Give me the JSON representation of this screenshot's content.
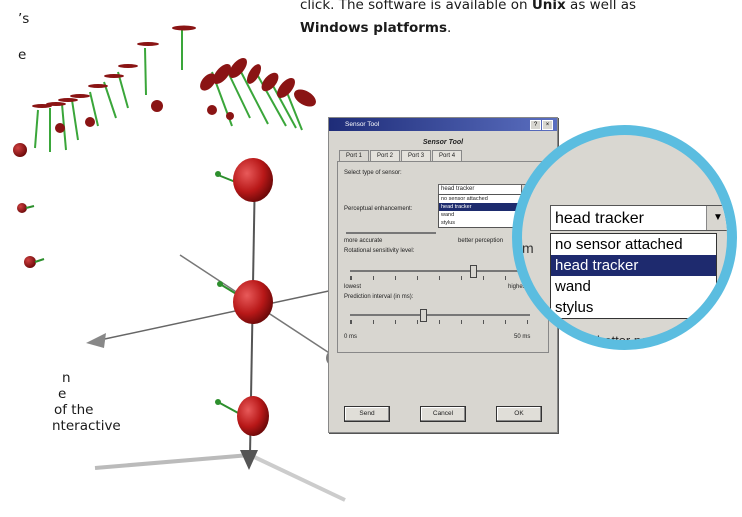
{
  "page_text": {
    "top_right_line1": "click. The software is available on ",
    "top_right_unix": "Unix",
    "top_right_line1_end": " as well as",
    "top_right_windows": "Windows platforms",
    "top_right_period": ".",
    "left_frag_1": "’s",
    "left_frag_2": "e",
    "left_frag_3": "n",
    "left_frag_4": "e",
    "left_frag_5": "of the",
    "left_frag_6": "nteractive"
  },
  "dialog": {
    "title": "Sensor Tool",
    "title_buttons": [
      "?",
      "×"
    ],
    "heading": "Sensor Tool",
    "tabs": [
      "Port 1",
      "Port 2",
      "Port 3",
      "Port 4"
    ],
    "active_tab": "Port 1",
    "select_type_label": "Select type of sensor:",
    "sensor_select_value": "head tracker",
    "sensor_options": [
      "no sensor attached",
      "head tracker",
      "wand",
      "stylus"
    ],
    "selected_option": "head tracker",
    "perceptual_label": "Perceptual enhancement:",
    "more_accurate": "more accurate",
    "better_perception": "better perception",
    "rotational_label": "Rotational sensitivity level:",
    "lowest": "lowest",
    "highest": "highest",
    "prediction_label": "Prediction interval (in ms):",
    "min_ms": "0 ms",
    "max_ms": "50 ms",
    "buttons": {
      "send": "Send",
      "cancel": "Cancel",
      "ok": "OK"
    }
  },
  "magnifier": {
    "select_value": "head tracker",
    "options": [
      "no sensor attached",
      "head tracker",
      "wand",
      "stylus"
    ],
    "selected_option": "head tracker",
    "partial_text": "better perception",
    "side_fragment": "m"
  },
  "colors": {
    "magnifier_ring": "#5bbde0",
    "selection_highlight": "#1e2a6e",
    "sphere_red": "#c41e1e",
    "arrow_green": "#3aa63a"
  }
}
